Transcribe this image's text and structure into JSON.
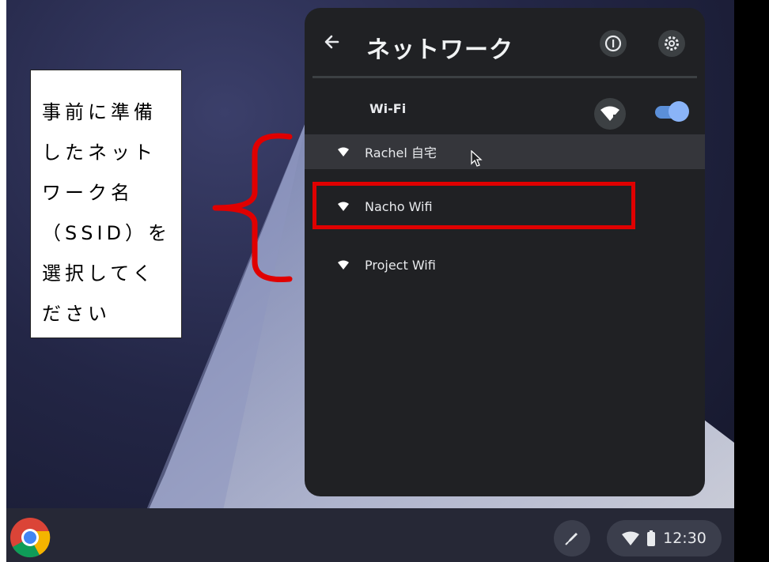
{
  "panel": {
    "title": "ネットワーク",
    "wifi_label": "Wi-Fi",
    "wifi_enabled": true,
    "networks": [
      "Rachel 自宅",
      "Nacho Wifi",
      "Project Wifi"
    ],
    "hovered_network": "Rachel 自宅",
    "highlighted_network": "Nacho Wifi"
  },
  "callout": {
    "text": "事前に準備\nしたネット\nワーク名\n（SSID）を\n選択してく\nださい"
  },
  "shelf": {
    "time": "12:30"
  },
  "colors": {
    "highlight_box": "#e00000",
    "toggle_on": "#8ab4f8",
    "panel_bg": "#202124"
  },
  "icons": [
    "back-arrow-icon",
    "info-icon",
    "settings-gear-icon",
    "wifi-icon",
    "chrome-icon",
    "stylus-icon",
    "battery-icon",
    "cursor-icon"
  ]
}
